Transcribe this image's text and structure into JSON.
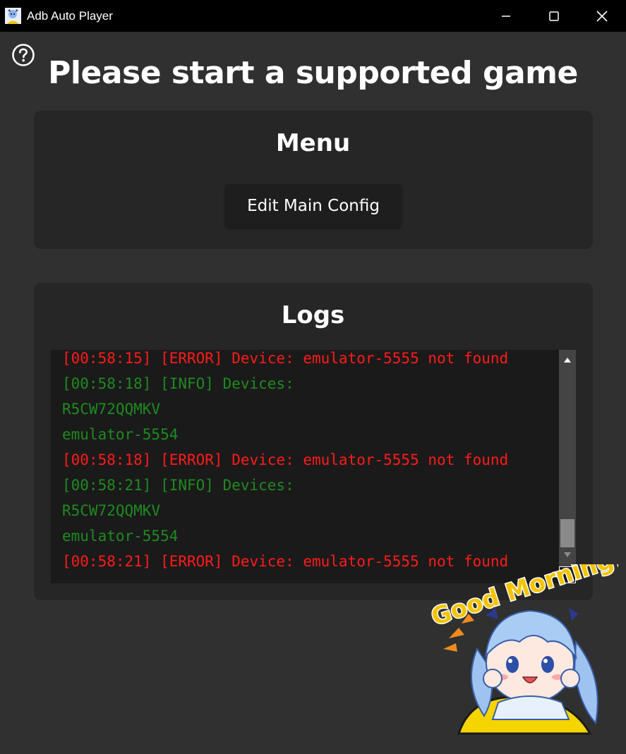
{
  "window": {
    "title": "Adb Auto Player",
    "minimize_icon": "minimize-icon",
    "maximize_icon": "maximize-icon",
    "close_icon": "close-icon"
  },
  "help": {
    "icon": "question-circle-icon"
  },
  "page": {
    "title": "Please start a supported game"
  },
  "menu": {
    "title": "Menu",
    "edit_config_label": "Edit Main Config"
  },
  "logs": {
    "title": "Logs",
    "lines": [
      {
        "text": "[00:58:15] [ERROR] Device: emulator-5555 not found",
        "level": "error"
      },
      {
        "text": "[00:58:18] [INFO] Devices:",
        "level": "info"
      },
      {
        "text": "R5CW72QQMKV",
        "level": "info"
      },
      {
        "text": "emulator-5554",
        "level": "info"
      },
      {
        "text": "[00:58:18] [ERROR] Device: emulator-5555 not found",
        "level": "error"
      },
      {
        "text": "[00:58:21] [INFO] Devices:",
        "level": "info"
      },
      {
        "text": "R5CW72QQMKV",
        "level": "info"
      },
      {
        "text": "emulator-5554",
        "level": "info"
      },
      {
        "text": "[00:58:21] [ERROR] Device: emulator-5555 not found",
        "level": "error"
      }
    ]
  },
  "mascot": {
    "greeting": "Good Morning!"
  },
  "colors": {
    "error": "#ff1a1a",
    "info": "#1f8a1f",
    "background": "#303030",
    "card": "#262626",
    "titlebar": "#000000"
  }
}
